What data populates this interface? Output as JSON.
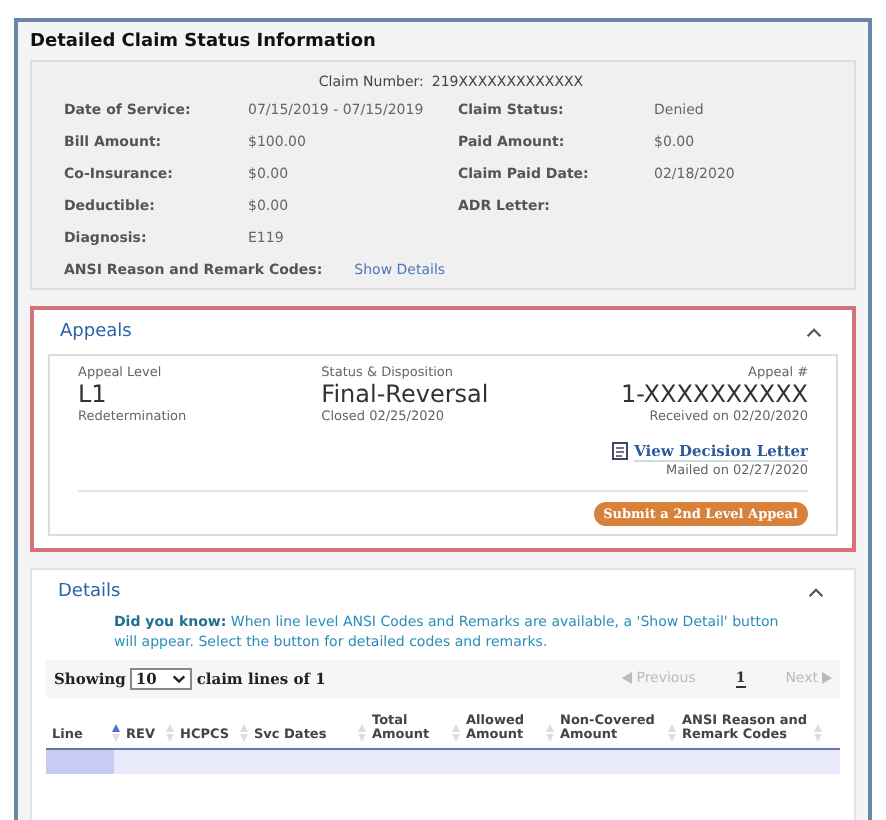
{
  "title": "Detailed Claim Status Information",
  "claim_number": {
    "label": "Claim Number:",
    "value": "219XXXXXXXXXXXXX"
  },
  "fields": [
    {
      "left": {
        "label": "Date of Service:",
        "value": "07/15/2019 - 07/15/2019"
      },
      "right": {
        "label": "Claim Status:",
        "value": "Denied"
      }
    },
    {
      "left": {
        "label": "Bill Amount:",
        "value": "$100.00"
      },
      "right": {
        "label": "Paid Amount:",
        "value": "$0.00"
      }
    },
    {
      "left": {
        "label": "Co-Insurance:",
        "value": "$0.00"
      },
      "right": {
        "label": "Claim Paid Date:",
        "value": "02/18/2020"
      }
    },
    {
      "left": {
        "label": "Deductible:",
        "value": "$0.00"
      },
      "right": {
        "label": "ADR Letter:"
      }
    },
    {
      "left": {
        "label": "Diagnosis:",
        "value": "E119"
      }
    }
  ],
  "ansi": {
    "label": "ANSI Reason and Remark Codes:",
    "link": "Show Details"
  },
  "appeals": {
    "title": "Appeals",
    "expanded": true,
    "highlighted": true,
    "level_label": "Appeal Level",
    "level": "L1",
    "level_sub": "Redetermination",
    "status_label": "Status & Disposition",
    "status": "Final-Reversal",
    "status_sub": "Closed 02/25/2020",
    "number_label": "Appeal #",
    "number": "1-XXXXXXXXXX",
    "received": "Received on 02/20/2020",
    "letter_link": "View Decision Letter",
    "mailed": "Mailed on 02/27/2020",
    "submit_button": "Submit a 2nd Level Appeal"
  },
  "details": {
    "title": "Details",
    "expanded": true,
    "tip": "**Did you know:** When line level ANSI Codes and Remarks are available, a 'Show Detail' button will appear. Select the button for detailed codes and remarks.",
    "showing_label": "Showing",
    "page_size": "10",
    "lines_text": "claim lines of 1",
    "pagination": [
      {
        "kind": "previous",
        "label": "Previous",
        "disabled": true,
        "selected": false
      },
      {
        "kind": "page",
        "label": "1",
        "disabled": false,
        "selected": true
      },
      {
        "kind": "next",
        "label": "Next",
        "disabled": true,
        "selected": false
      }
    ],
    "columns": [
      {
        "label": "Line",
        "sorted": true
      },
      {
        "label": "REV",
        "sorted": false
      },
      {
        "label": "HCPCS",
        "sorted": false
      },
      {
        "label": "Svc Dates",
        "sorted": false
      },
      {
        "label": "Total Amount",
        "sorted": false
      },
      {
        "label": "Allowed Amount",
        "sorted": false
      },
      {
        "label": "Non-Covered Amount",
        "sorted": false
      },
      {
        "label": "ANSI Reason and Remark Codes",
        "sorted": false
      }
    ]
  }
}
